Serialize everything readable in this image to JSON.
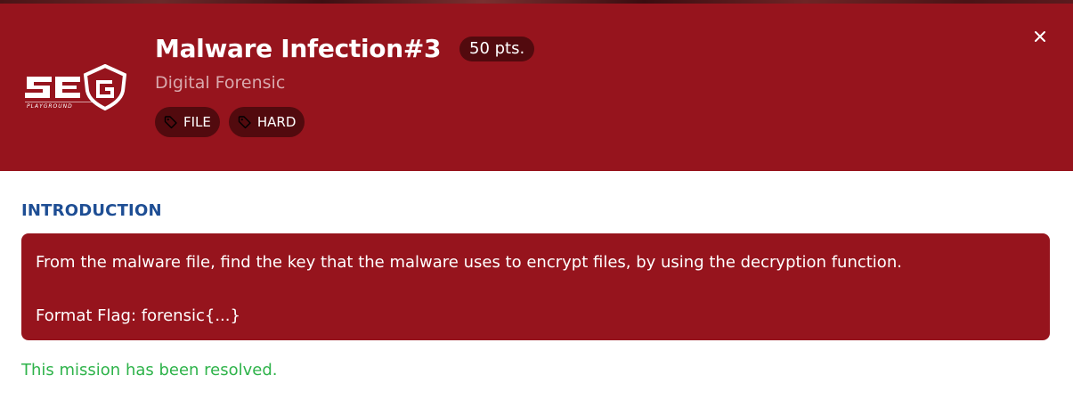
{
  "modal": {
    "title": "Malware Infection#3",
    "points": "50 pts.",
    "category": "Digital Forensic",
    "tags": [
      "FILE",
      "HARD"
    ],
    "close_icon": "close-icon",
    "logo": {
      "text": "SEG",
      "subtext": "PLAYGROUND"
    }
  },
  "introduction": {
    "heading": "INTRODUCTION",
    "lines": [
      "From the malware file, find the key that the malware uses to encrypt files, by using the decryption function.",
      "Format Flag: forensic{...}"
    ]
  },
  "status": {
    "message": "This mission has been resolved."
  },
  "colors": {
    "header_bg": "#96141d",
    "pill_bg": "#520a0e",
    "heading_blue": "#1e4e94",
    "success_green": "#2eb34a"
  }
}
